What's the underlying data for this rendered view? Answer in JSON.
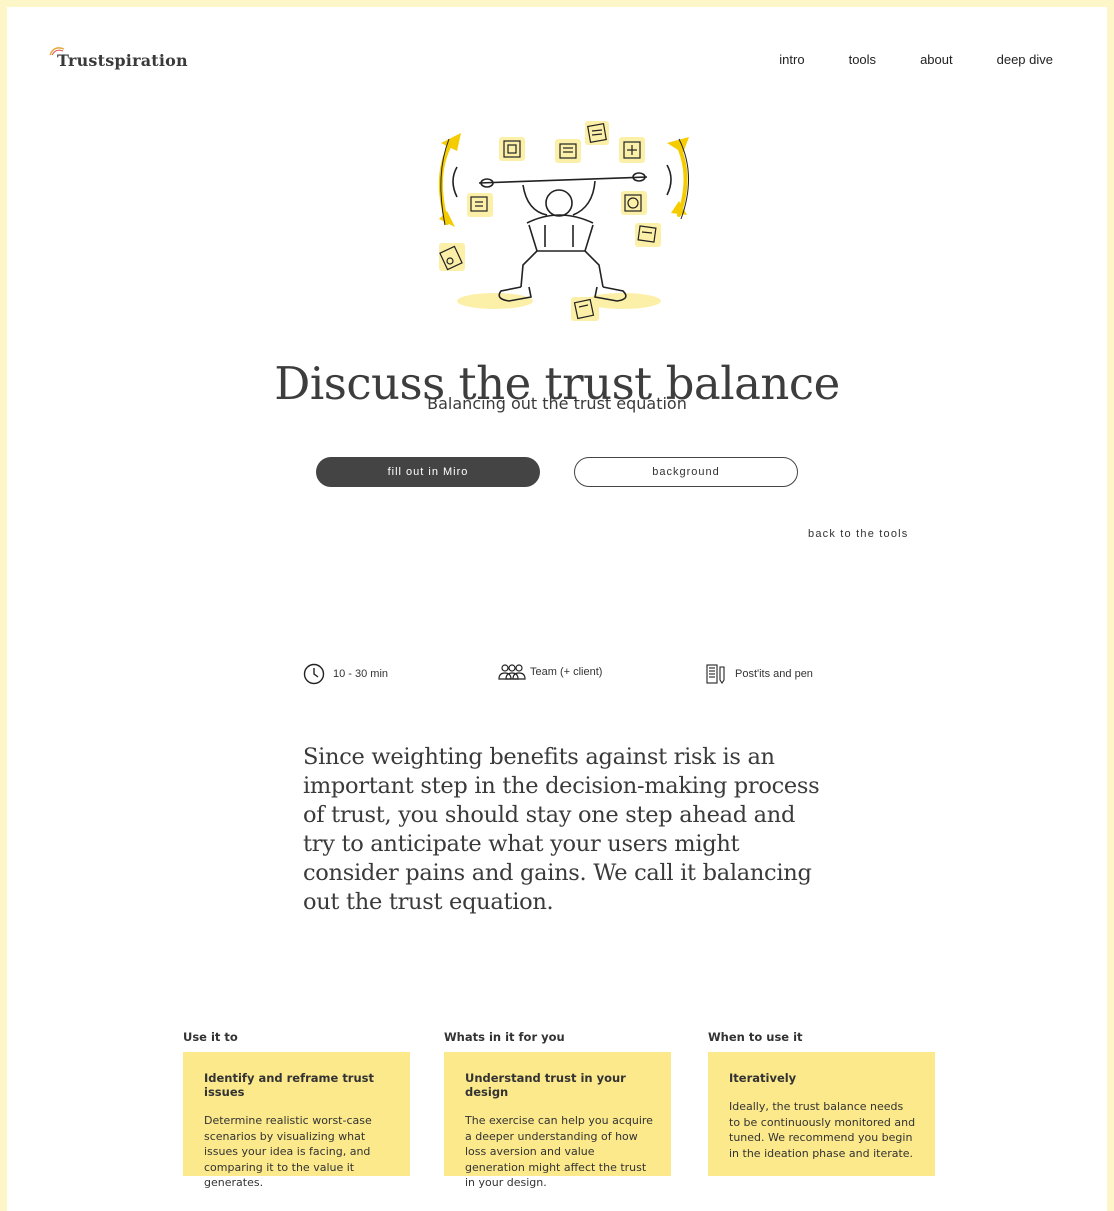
{
  "header": {
    "logo_text": "Trustspiration",
    "nav": [
      "intro",
      "tools",
      "about",
      "deep dive"
    ]
  },
  "hero": {
    "title": "Discuss the trust balance",
    "subtitle": "Balancing out the trust equation",
    "primary_button": "fill out in Miro",
    "secondary_button": "background",
    "back_link": "back to the tools"
  },
  "meta": {
    "time": "10 - 30 min",
    "team": "Team (+ client)",
    "materials": "Post'its and pen"
  },
  "intro_text": "Since weighting benefits against risk is an important step in the decision-making process of trust, you should stay one step ahead and try to anticipate what your users might consider pains and gains. We call it balancing out the trust equation.",
  "columns": [
    {
      "heading": "Use it to",
      "card_title": "Identify and reframe trust issues",
      "card_body": "Determine realistic worst-case scenarios by visualizing what issues your idea is facing, and comparing it to the value it generates."
    },
    {
      "heading": "Whats in it for you",
      "card_title": "Understand trust in your design",
      "card_body": "The exercise can help you acquire a deeper understanding of how loss aversion and value generation might affect the trust in your design."
    },
    {
      "heading": "When to use it",
      "card_title": "Iteratively",
      "card_body": "Ideally, the trust balance needs to be continuously monitored and tuned. We recommend you begin in the ideation phase and iterate."
    }
  ],
  "colors": {
    "background": "#fdf6c8",
    "card": "#fbe98c",
    "accent": "#f5cc00",
    "button_dark": "#444444"
  }
}
